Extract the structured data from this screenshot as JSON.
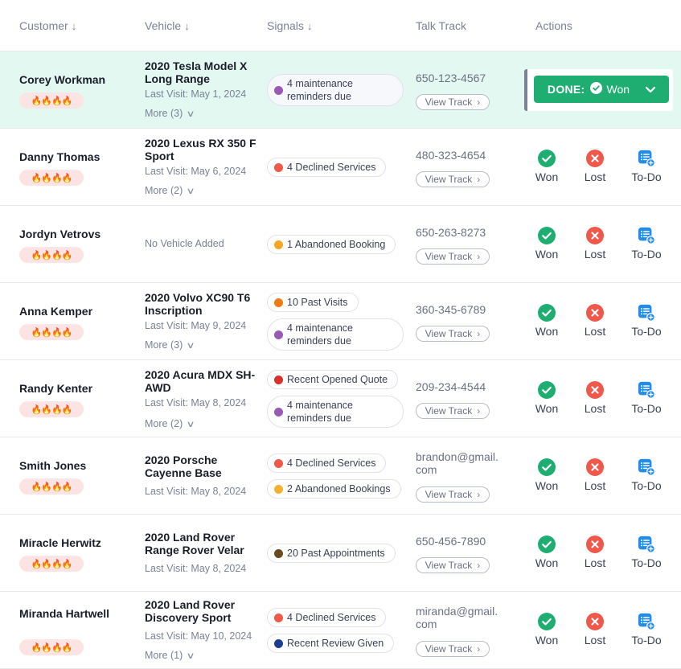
{
  "header": {
    "customer": "Customer",
    "vehicle": "Vehicle",
    "signals": "Signals",
    "talk_track": "Talk Track",
    "actions": "Actions",
    "sort_arrow": "↓"
  },
  "labels": {
    "view_track": "View Track",
    "won": "Won",
    "lost": "Lost",
    "todo": "To-Do",
    "done_prefix": "DONE:",
    "done_value": "Won",
    "no_vehicle": "No Vehicle Added",
    "flames": "🔥🔥🔥🔥"
  },
  "colors": {
    "highlight_row": "#e3f8f0",
    "won_green": "#1fae72",
    "lost_red": "#f0584a",
    "todo_blue": "#1e8cf2",
    "flame_bg": "#fde4e4"
  },
  "rows": [
    {
      "name": "Corey Workman",
      "vehicle": "2020 Tesla Model X Long Range",
      "last_visit": "Last Visit:  May 1, 2024",
      "more": "More (3)",
      "signals": [
        {
          "text": "4 maintenance reminders due",
          "color": "#9b59b6"
        }
      ],
      "contact": "650-123-4567",
      "done": true
    },
    {
      "name": "Danny Thomas",
      "vehicle": "2020 Lexus RX 350 F Sport",
      "last_visit": "Last Visit:  May 6, 2024",
      "more": "More (2)",
      "signals": [
        {
          "text": "4 Declined Services",
          "color": "#f0584a"
        }
      ],
      "contact": "480-323-4654"
    },
    {
      "name": "Jordyn Vetrovs",
      "vehicle": "",
      "signals": [
        {
          "text": "1 Abandoned Booking",
          "color": "#f5a623"
        }
      ],
      "contact": "650-263-8273"
    },
    {
      "name": "Anna Kemper",
      "vehicle": "2020 Volvo XC90 T6 Inscription",
      "last_visit": "Last Visit:  May 9, 2024",
      "more": "More (3)",
      "signals": [
        {
          "text": "10 Past Visits",
          "color": "#f07b12"
        },
        {
          "text": "4 maintenance reminders due",
          "color": "#9b59b6"
        }
      ],
      "contact": "360-345-6789"
    },
    {
      "name": "Randy Kenter",
      "vehicle": "2020 Acura MDX SH-AWD",
      "last_visit": "Last Visit:  May 8, 2024",
      "more": "More (2)",
      "signals": [
        {
          "text": "Recent Opened Quote",
          "color": "#d9302c"
        },
        {
          "text": "4 maintenance reminders due",
          "color": "#9b59b6"
        }
      ],
      "contact": "209-234-4544"
    },
    {
      "name": "Smith Jones",
      "vehicle": "2020 Porsche Cayenne Base",
      "last_visit": "Last Visit:  May 8, 2024",
      "signals": [
        {
          "text": "4 Declined Services",
          "color": "#f0584a"
        },
        {
          "text": "2 Abandoned Bookings",
          "color": "#f5b031"
        }
      ],
      "contact": "brandon@gmail.com"
    },
    {
      "name": "Miracle Herwitz",
      "vehicle": "2020 Land Rover Range Rover Velar",
      "last_visit": "Last Visit:  May 8, 2024",
      "signals": [
        {
          "text": "20 Past Appointments",
          "color": "#6b4a1e"
        }
      ],
      "contact": "650-456-7890"
    },
    {
      "name": "Miranda Hartwell",
      "vehicle": "2020 Land Rover Discovery Sport",
      "last_visit": "Last Visit:  May 10, 2024",
      "more": "More (1)",
      "signals": [
        {
          "text": "4 Declined Services",
          "color": "#f0584a"
        },
        {
          "text": "Recent Review Given",
          "color": "#1a3f8f"
        }
      ],
      "contact": "miranda@gmail.com"
    }
  ]
}
